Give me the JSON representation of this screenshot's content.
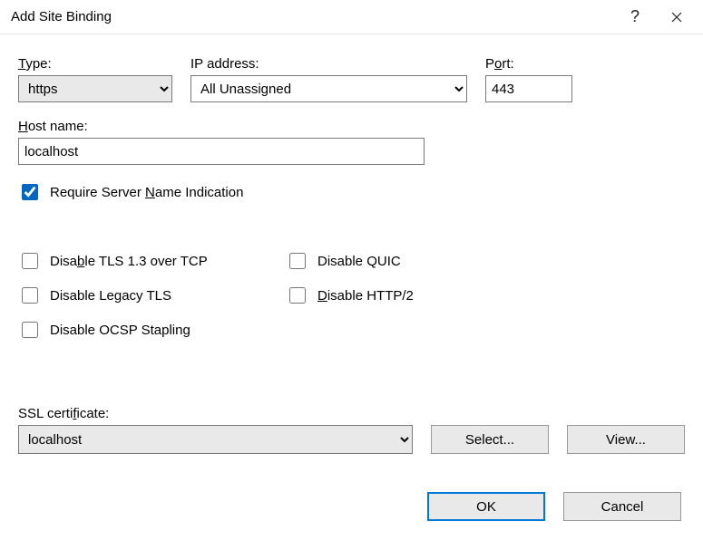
{
  "window": {
    "title": "Add Site Binding"
  },
  "labels": {
    "type": "ype:",
    "type_u": "T",
    "ip": "IP address:",
    "port": "rt:",
    "port_pre": "P",
    "port_u": "o",
    "host": "ost name:",
    "host_u": "H",
    "require_sni_pre": "Require Server ",
    "require_sni_u": "N",
    "require_sni_post": "ame Indication",
    "disable_tls13_pre": "Disa",
    "disable_tls13_u": "b",
    "disable_tls13_post": "le TLS 1.3 over TCP",
    "disable_quic": "Disable QUIC",
    "disable_legacy_tls": "Disable Legacy TLS",
    "disable_http2_pre": "",
    "disable_http2_u": "D",
    "disable_http2_post": "isable HTTP/2",
    "disable_ocsp": "Disable OCSP Stapling",
    "ssl_pre": "SSL certi",
    "ssl_u": "f",
    "ssl_post": "icate:"
  },
  "values": {
    "type": "https",
    "ip": "All Unassigned",
    "port": "443",
    "host": "localhost",
    "require_sni": true,
    "disable_tls13": false,
    "disable_quic": false,
    "disable_legacy_tls": false,
    "disable_http2": false,
    "disable_ocsp": false,
    "ssl_cert": "localhost"
  },
  "buttons": {
    "select": "Select...",
    "view": "View...",
    "ok": "OK",
    "cancel": "Cancel"
  }
}
